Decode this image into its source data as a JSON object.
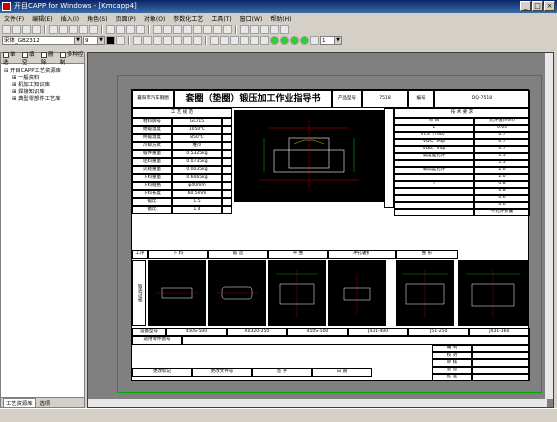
{
  "window": {
    "title": "开目CAPP for Windows - [Kmcapp4]"
  },
  "menu": [
    "文件(F)",
    "编辑(E)",
    "插入(I)",
    "角色(S)",
    "页面(P)",
    "对象(O)",
    "参数化工艺",
    "工具(T)",
    "窗口(W)",
    "帮助(H)"
  ],
  "toolbar": {
    "font_combo": "宋体_GB2312",
    "size_combo": "9",
    "page_combo": "1"
  },
  "leftpane": {
    "checks": [
      "单选",
      "填空",
      "删除",
      "多种控制"
    ],
    "tree": [
      "开目CAPP工艺资源库",
      "一般资料",
      "机加工知识库",
      "焊接知识库",
      "典型零部件工艺库"
    ],
    "tabs": [
      "工艺资源库",
      "选项"
    ]
  },
  "sheet": {
    "company": "襄阳市汽车钢圈",
    "title": "套圈（垫圈）锻压加工作业指导书",
    "part_no_label": "产品型号",
    "part_no": "7518",
    "doc_no_label": "编号",
    "doc_no": "DQ-7518",
    "process_header": "工 艺 规 范",
    "params": [
      [
        "材料牌号",
        "GCr15"
      ],
      [
        "始锻温度",
        "1050℃"
      ],
      [
        "终锻温度",
        "850℃"
      ],
      [
        "冷却方式",
        "堆冷"
      ],
      [
        "锻件重量",
        "0.5325kg"
      ],
      [
        "坯料重量",
        "0.0735kg"
      ],
      [
        "火耗重量",
        "0.0035kg"
      ],
      [
        "下料重量",
        "0.6065kg"
      ],
      [
        "下料规格",
        "φ40mm"
      ],
      [
        "下料长度",
        "60.5mm"
      ],
      [
        "锻比",
        "1.5"
      ],
      [
        "镦比",
        "1.4"
      ]
    ],
    "tech_header": "技 术 要 求",
    "tech_rows": [
      [
        "项 目",
        "允许值(mm)"
      ],
      [
        "L",
        "0.63"
      ],
      [
        "VCS（70b）",
        "0.7"
      ],
      [
        "VDs、Vdp",
        "0.7"
      ],
      [
        "VDb、Vdp",
        "0.7"
      ],
      [
        "高度差允许",
        "1.5"
      ],
      [
        "",
        "1.5"
      ],
      [
        "非高度允许",
        "2.0"
      ],
      [
        "",
        "2.0"
      ],
      [
        "T",
        "0.8"
      ],
      [
        "",
        "0.8"
      ],
      [
        "",
        "0.6"
      ],
      [
        "",
        "0.6"
      ],
      [
        "",
        "不允许折叠"
      ]
    ],
    "steps_header": [
      "工序",
      "下 料",
      "锻 造",
      "平 整",
      "冲孔辗扩",
      "整 形"
    ],
    "side_label": "锻造过程",
    "equip_label": "设备型号",
    "equip": [
      "450S-500",
      "X0320-250",
      "450S-500",
      "J431-400",
      "J51-250",
      "J431-160"
    ],
    "notes": "适用零件图号",
    "sign_row": [
      "更改标记",
      "更改文件号",
      "签 字",
      "日 期"
    ],
    "sign_right": [
      "编 制",
      "校 对",
      "审 核",
      "会 签",
      "批 准"
    ]
  }
}
